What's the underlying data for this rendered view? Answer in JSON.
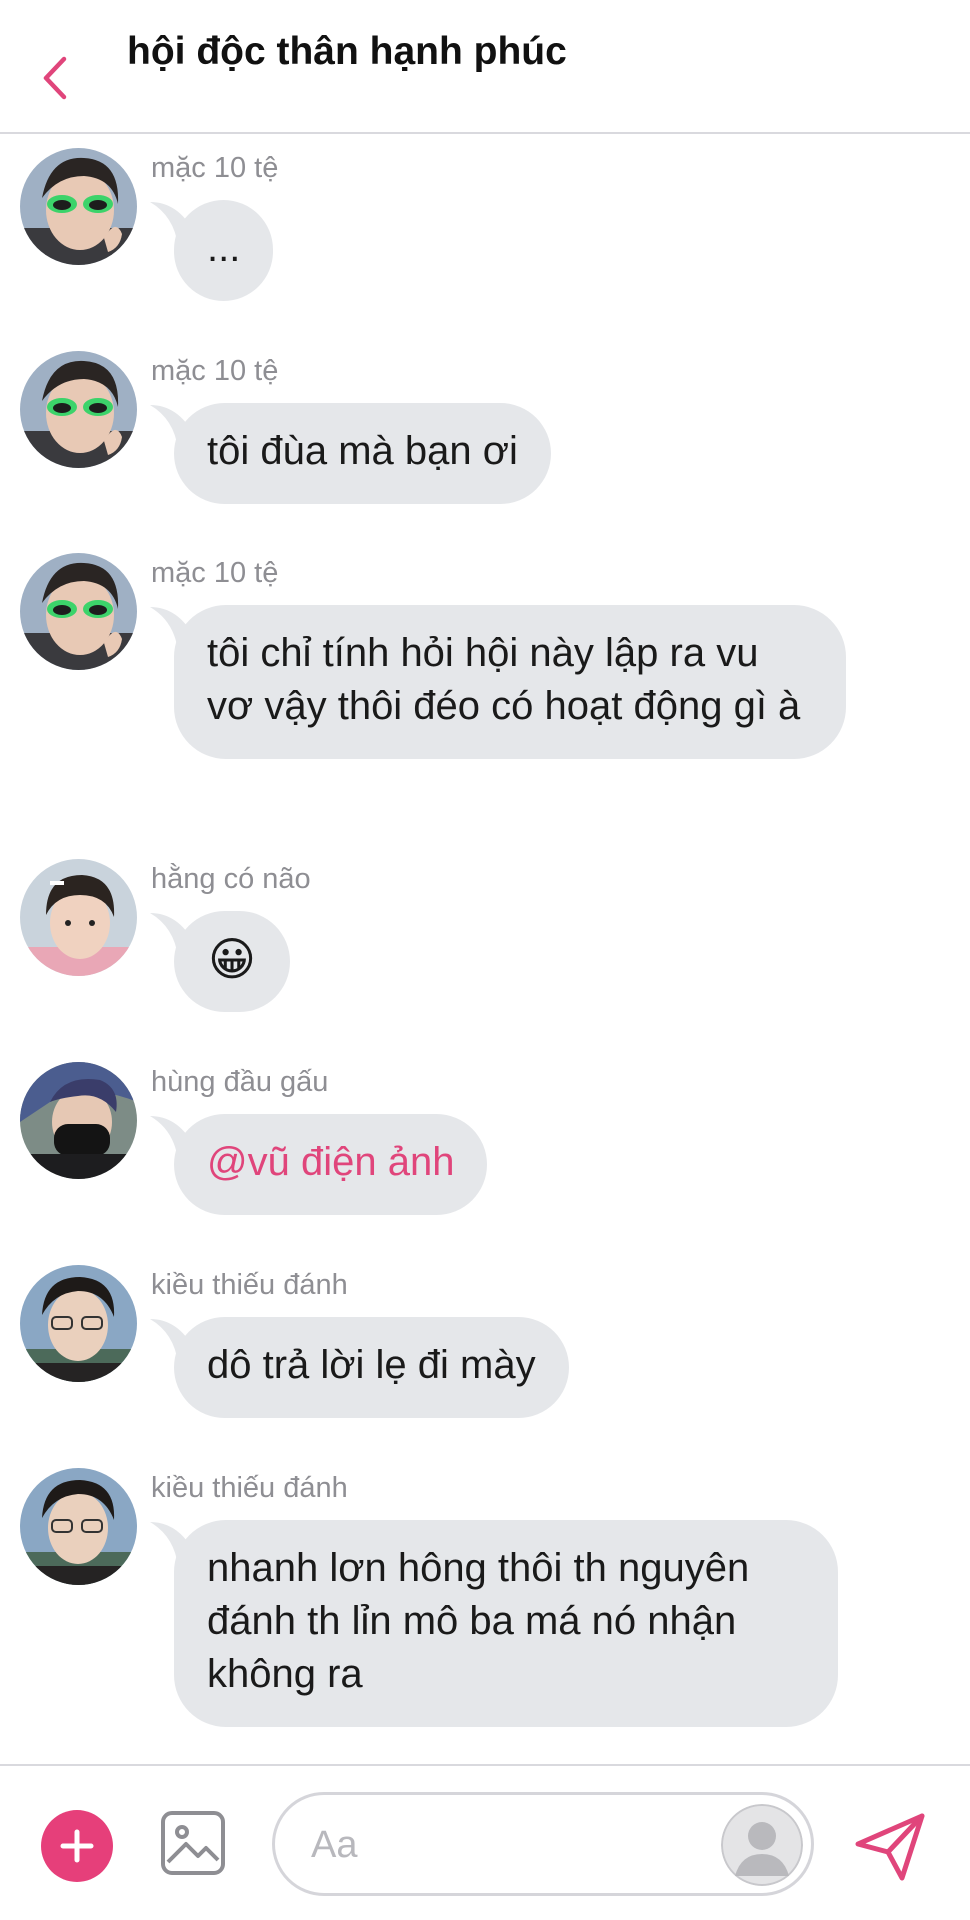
{
  "header": {
    "title": "hội độc thân hạnh phúc",
    "back_icon": "chevron-left-icon",
    "accent_color": "#e0457b"
  },
  "messages": [
    {
      "sender": "mặc 10 tệ",
      "text": "...",
      "avatar": "avatar-green-glasses"
    },
    {
      "sender": "mặc 10 tệ",
      "text": "tôi đùa mà bạn ơi",
      "avatar": "avatar-green-glasses"
    },
    {
      "sender": "mặc 10 tệ",
      "text": "tôi chỉ tính hỏi hội này lập ra vu vơ vậy thôi đéo có hoạt động gì à",
      "avatar": "avatar-green-glasses"
    },
    {
      "sender": "hằng có não",
      "text": "😀",
      "avatar": "avatar-boy-pink-shirt"
    },
    {
      "sender": "hùng đầu gấu",
      "text": "@vũ điện ảnh",
      "avatar": "avatar-black-mask"
    },
    {
      "sender": "kiều thiếu đánh",
      "text": "dô trả lời lẹ đi mày",
      "avatar": "avatar-glasses-curly"
    },
    {
      "sender": "kiều thiếu đánh",
      "text": "nhanh lơn hông thôi th nguyên đánh th lỉn mô ba má nó nhận không ra",
      "avatar": "avatar-glasses-curly"
    }
  ],
  "composer": {
    "placeholder": "Aa",
    "plus_icon": "plus-icon",
    "image_icon": "image-icon",
    "send_icon": "send-icon",
    "plus_color": "#e63f7a"
  }
}
